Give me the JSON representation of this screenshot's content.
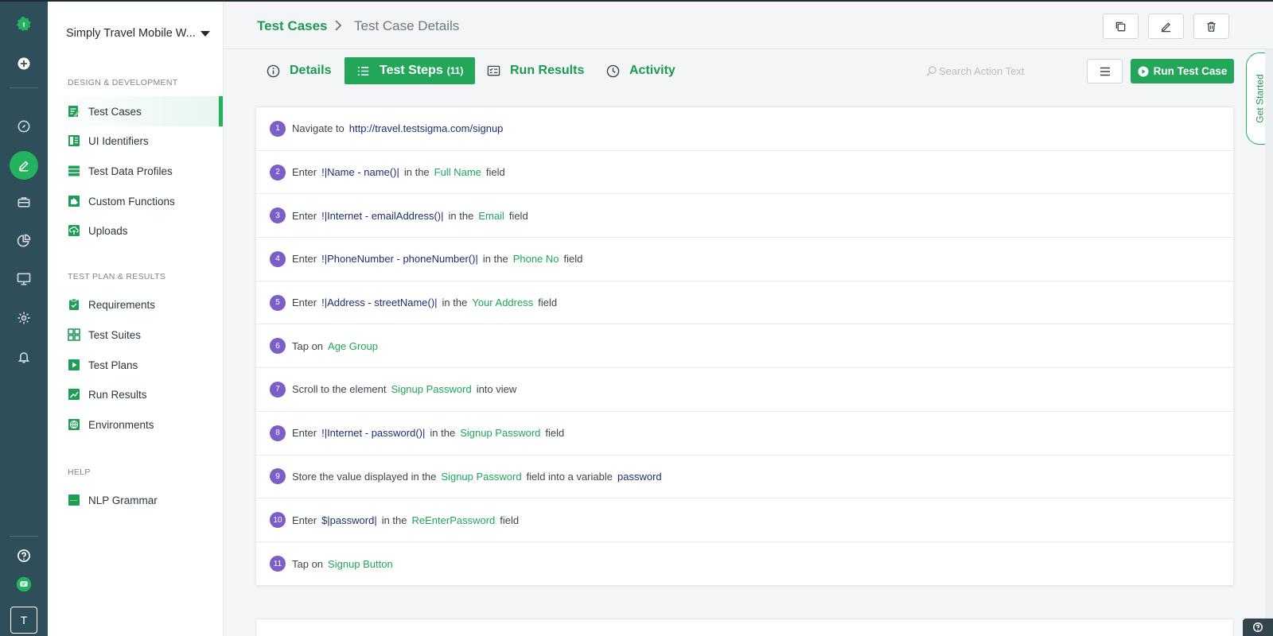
{
  "sidebar": {
    "workspace": "Simply Travel Mobile W...",
    "sections": [
      {
        "title": "DESIGN & DEVELOPMENT"
      },
      {
        "title": "TEST PLAN & RESULTS"
      },
      {
        "title": "HELP"
      }
    ],
    "items": [
      {
        "label": "Test Cases",
        "icon": "test-cases-icon",
        "active": true
      },
      {
        "label": "UI Identifiers",
        "icon": "ui-identifiers-icon"
      },
      {
        "label": "Test Data Profiles",
        "icon": "test-data-icon"
      },
      {
        "label": "Custom Functions",
        "icon": "puzzle-icon"
      },
      {
        "label": "Uploads",
        "icon": "upload-icon"
      },
      {
        "label": "Requirements",
        "icon": "clipboard-icon"
      },
      {
        "label": "Test Suites",
        "icon": "suites-icon"
      },
      {
        "label": "Test Plans",
        "icon": "play-icon"
      },
      {
        "label": "Run Results",
        "icon": "chart-icon"
      },
      {
        "label": "Environments",
        "icon": "globe-icon"
      },
      {
        "label": "NLP Grammar",
        "icon": "abc-icon"
      }
    ]
  },
  "rail": {
    "avatar": "T"
  },
  "header": {
    "breadcrumb_root": "Test Cases",
    "breadcrumb_current": "Test Case Details"
  },
  "tabs": [
    {
      "label": "Details",
      "icon": "info-icon"
    },
    {
      "label": "Test Steps",
      "count": "(11)",
      "icon": "list-icon",
      "active": true
    },
    {
      "label": "Run Results",
      "icon": "results-icon"
    },
    {
      "label": "Activity",
      "icon": "clock-icon"
    }
  ],
  "search": {
    "placeholder": "Search Action Text"
  },
  "run_button": "Run Test Case",
  "get_started": "Get Started",
  "steps": [
    {
      "num": "1",
      "parts": [
        [
          "t",
          "Navigate to"
        ],
        [
          "v",
          "http://travel.testsigma.com/signup"
        ]
      ]
    },
    {
      "num": "2",
      "parts": [
        [
          "t",
          "Enter"
        ],
        [
          "v",
          "!|Name - name()|"
        ],
        [
          "t",
          "in the"
        ],
        [
          "e",
          "Full Name"
        ],
        [
          "t",
          "field"
        ]
      ]
    },
    {
      "num": "3",
      "parts": [
        [
          "t",
          "Enter"
        ],
        [
          "v",
          "!|Internet - emailAddress()|"
        ],
        [
          "t",
          "in the"
        ],
        [
          "e",
          "Email"
        ],
        [
          "t",
          "field"
        ]
      ]
    },
    {
      "num": "4",
      "parts": [
        [
          "t",
          "Enter"
        ],
        [
          "v",
          "!|PhoneNumber - phoneNumber()|"
        ],
        [
          "t",
          "in the"
        ],
        [
          "e",
          "Phone No"
        ],
        [
          "t",
          "field"
        ]
      ]
    },
    {
      "num": "5",
      "parts": [
        [
          "t",
          "Enter"
        ],
        [
          "v",
          "!|Address - streetName()|"
        ],
        [
          "t",
          "in the"
        ],
        [
          "e",
          "Your Address"
        ],
        [
          "t",
          "field"
        ]
      ]
    },
    {
      "num": "6",
      "parts": [
        [
          "t",
          "Tap on"
        ],
        [
          "e",
          "Age Group"
        ]
      ]
    },
    {
      "num": "7",
      "parts": [
        [
          "t",
          "Scroll to the element"
        ],
        [
          "e",
          "Signup Password"
        ],
        [
          "t",
          "into view"
        ]
      ]
    },
    {
      "num": "8",
      "parts": [
        [
          "t",
          "Enter"
        ],
        [
          "v",
          "!|Internet - password()|"
        ],
        [
          "t",
          "in the"
        ],
        [
          "e",
          "Signup Password"
        ],
        [
          "t",
          "field"
        ]
      ]
    },
    {
      "num": "9",
      "parts": [
        [
          "t",
          "Store the value displayed in the"
        ],
        [
          "e",
          "Signup Password"
        ],
        [
          "t",
          "field into a variable"
        ],
        [
          "v",
          "password"
        ]
      ]
    },
    {
      "num": "10",
      "parts": [
        [
          "t",
          "Enter"
        ],
        [
          "v",
          "$|password|"
        ],
        [
          "t",
          "in the"
        ],
        [
          "e",
          "ReEnterPassword"
        ],
        [
          "t",
          "field"
        ]
      ]
    },
    {
      "num": "11",
      "parts": [
        [
          "t",
          "Tap on"
        ],
        [
          "e",
          "Signup Button"
        ]
      ]
    }
  ],
  "colors": {
    "brand_green": "#23a65a",
    "rail_bg": "#2e4f5a",
    "step_badge": "#7b5fc8",
    "value_text": "#1a2f72",
    "element_text": "#1fa55c"
  }
}
